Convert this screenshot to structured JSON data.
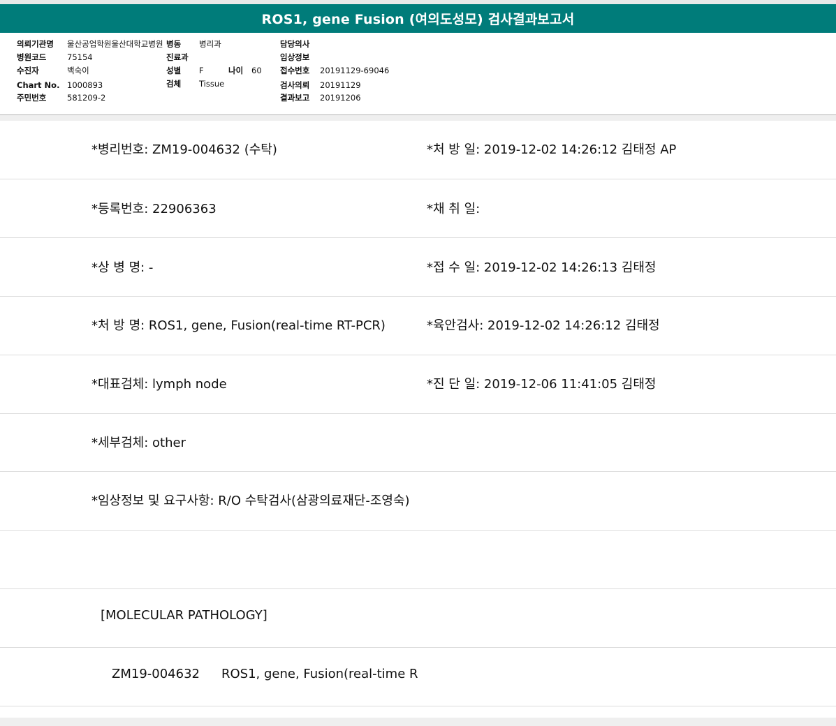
{
  "title": "ROS1, gene Fusion (여의도성모) 검사결과보고서",
  "header": {
    "col1": [
      {
        "label": "의뢰기관명",
        "value": "울산공업학원울산대학교병원"
      },
      {
        "label": "병원코드",
        "value": "75154"
      },
      {
        "label": "수진자",
        "value": "백숙이"
      },
      {
        "label": "Chart No.",
        "value": "1000893"
      },
      {
        "label": "주민번호",
        "value": "581209-2"
      }
    ],
    "col2": [
      {
        "label": "병동",
        "value": "병리과"
      },
      {
        "label": "진료과",
        "value": ""
      },
      {
        "label": "성별",
        "value": "F"
      },
      {
        "label": "검체",
        "value": "Tissue"
      }
    ],
    "age": {
      "label": "나이",
      "value": "60"
    },
    "col3": [
      {
        "label": "담당의사",
        "value": ""
      },
      {
        "label": "임상정보",
        "value": ""
      },
      {
        "label": "접수번호",
        "value": "20191129-69046"
      },
      {
        "label": "검사의뢰",
        "value": "20191129"
      },
      {
        "label": "결과보고",
        "value": "20191206"
      }
    ]
  },
  "report": {
    "path_no": "*병리번호: ZM19-004632 (수탁)",
    "order_date": "*처 방 일: 2019-12-02 14:26:12  김태정 AP",
    "reg_no": "*등록번호: 22906363",
    "collect_date": "*채 취 일:",
    "diagnosis": "*상 병 명: -",
    "receipt_date": "*접 수 일: 2019-12-02 14:26:13  김태정",
    "order_name": "*처 방 명: ROS1, gene, Fusion(real-time RT-PCR)",
    "gross_exam": "*육안검사: 2019-12-02 14:26:12  김태정",
    "specimen": "*대표검체: lymph node",
    "diag_date": "*진 단 일: 2019-12-06 11:41:05  김태정",
    "sub_specimen": "*세부검체: other",
    "clinical_info": "*임상정보 및 요구사항: R/O 수탁검사(삼광의료재단-조영숙)",
    "section": "[MOLECULAR PATHOLOGY]",
    "result_line_no": "ZM19-004632",
    "result_line_test": "ROS1, gene, Fusion(real-time R"
  }
}
